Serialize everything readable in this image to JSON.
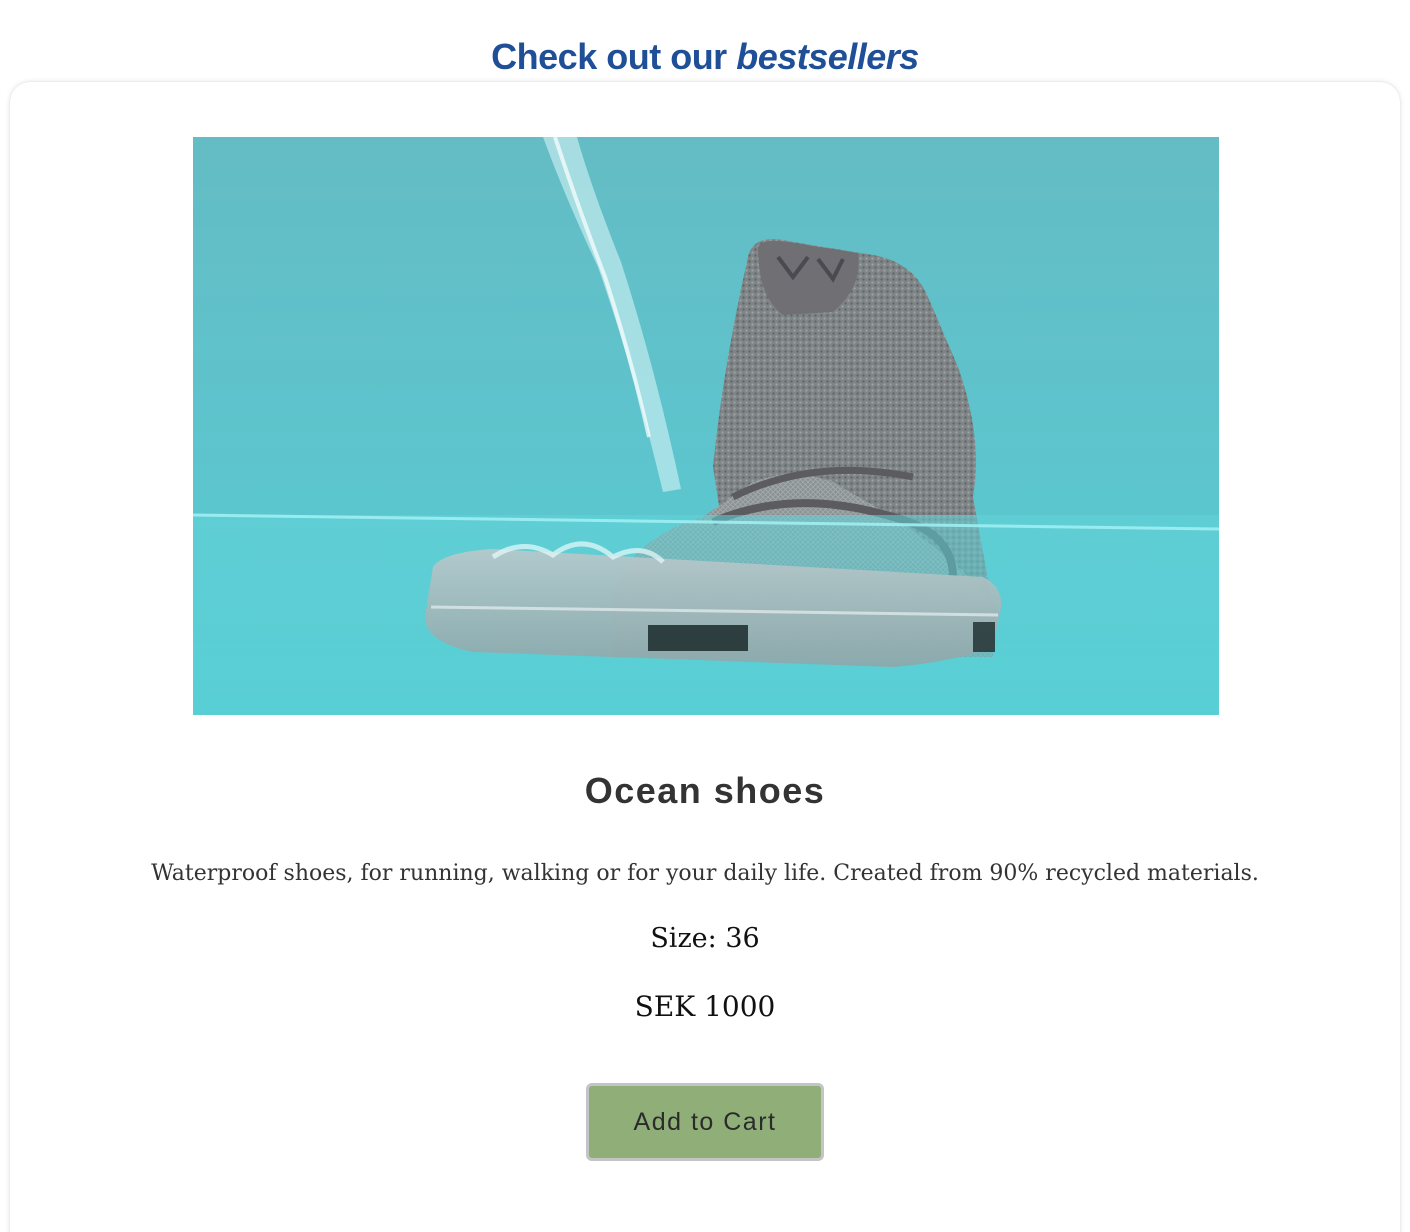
{
  "header": {
    "title_prefix": "Check out our ",
    "title_emphasis": "bestsellers"
  },
  "product": {
    "name": "Ocean shoes",
    "description": "Waterproof shoes, for running, walking or for your daily life. Created from 90% recycled materials.",
    "size_text": "Size: 36",
    "price_text": "SEK 1000",
    "add_to_cart_label": "Add to Cart",
    "image_alt": "Ocean shoes"
  },
  "colors": {
    "heading": "#1f4f96",
    "button_bg": "#8fae78",
    "water": "#5ed1d6"
  },
  "icons": {
    "product_image": "sneaker-in-water-image"
  }
}
